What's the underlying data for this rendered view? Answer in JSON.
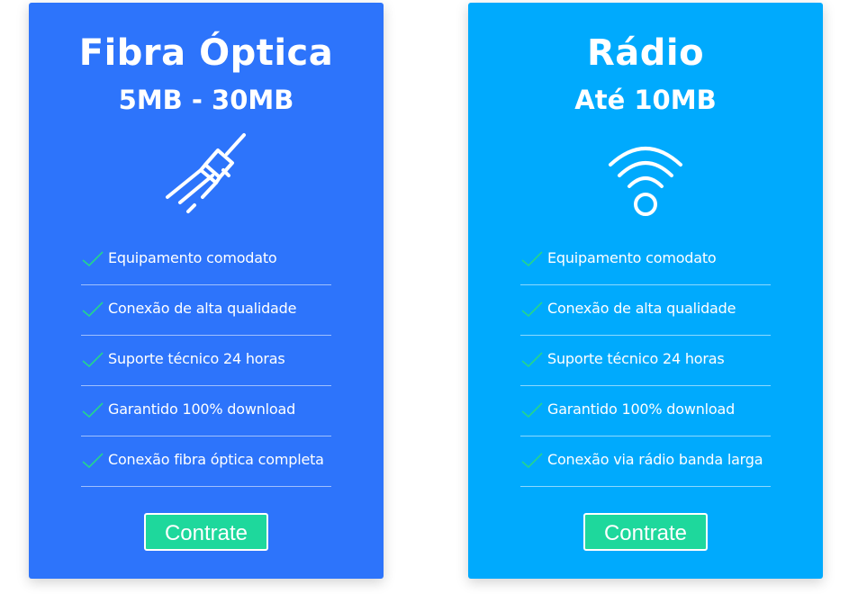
{
  "colors": {
    "fiber_card": "#2D74FB",
    "radio_card": "#00AAFD",
    "button": "#1ED89C",
    "check": "#24D58E",
    "text": "#FFFFFF"
  },
  "plans": [
    {
      "title": "Fibra Óptica",
      "speed": "5MB - 30MB",
      "icon": "fiber-cable-icon",
      "features": [
        "Equipamento comodato",
        "Conexão de alta qualidade",
        "Suporte técnico 24 horas",
        "Garantido 100% download",
        "Conexão fibra óptica completa"
      ],
      "cta_label": "Contrate"
    },
    {
      "title": "Rádio",
      "speed": "Até 10MB",
      "icon": "wifi-icon",
      "features": [
        "Equipamento comodato",
        "Conexão de alta qualidade",
        "Suporte técnico 24 horas",
        "Garantido 100% download",
        "Conexão via rádio banda larga"
      ],
      "cta_label": "Contrate"
    }
  ]
}
